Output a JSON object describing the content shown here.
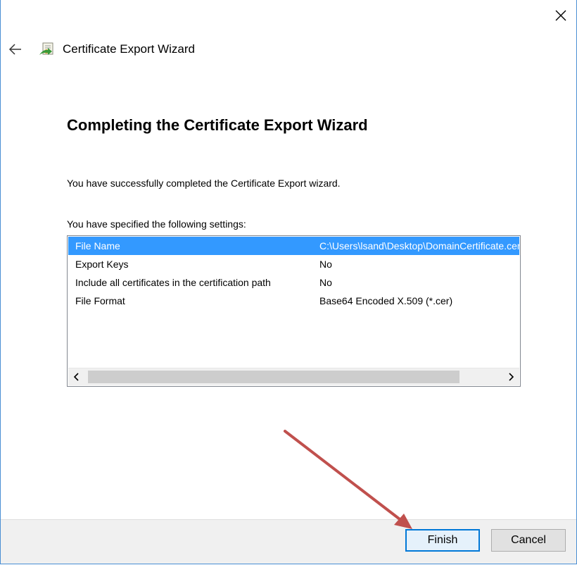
{
  "window": {
    "close_icon": "close-icon"
  },
  "nav": {
    "back_icon": "back-arrow-icon",
    "wizard_icon": "certificate-wizard-icon",
    "title": "Certificate Export Wizard"
  },
  "main": {
    "heading": "Completing the Certificate Export Wizard",
    "success_text": "You have successfully completed the Certificate Export wizard.",
    "settings_label": "You have specified the following settings:"
  },
  "settings": {
    "rows": [
      {
        "name": "File Name",
        "value": "C:\\Users\\lsand\\Desktop\\DomainCertificate.cer",
        "selected": true
      },
      {
        "name": "Export Keys",
        "value": "No",
        "selected": false
      },
      {
        "name": "Include all certificates in the certification path",
        "value": "No",
        "selected": false
      },
      {
        "name": "File Format",
        "value": "Base64 Encoded X.509 (*.cer)",
        "selected": false
      }
    ],
    "scroll_left_icon": "chevron-left-icon",
    "scroll_right_icon": "chevron-right-icon"
  },
  "footer": {
    "finish_label": "Finish",
    "cancel_label": "Cancel"
  },
  "colors": {
    "selection": "#3399ff",
    "annotation_arrow": "#c0504d",
    "default_button_border": "#0078d7"
  }
}
